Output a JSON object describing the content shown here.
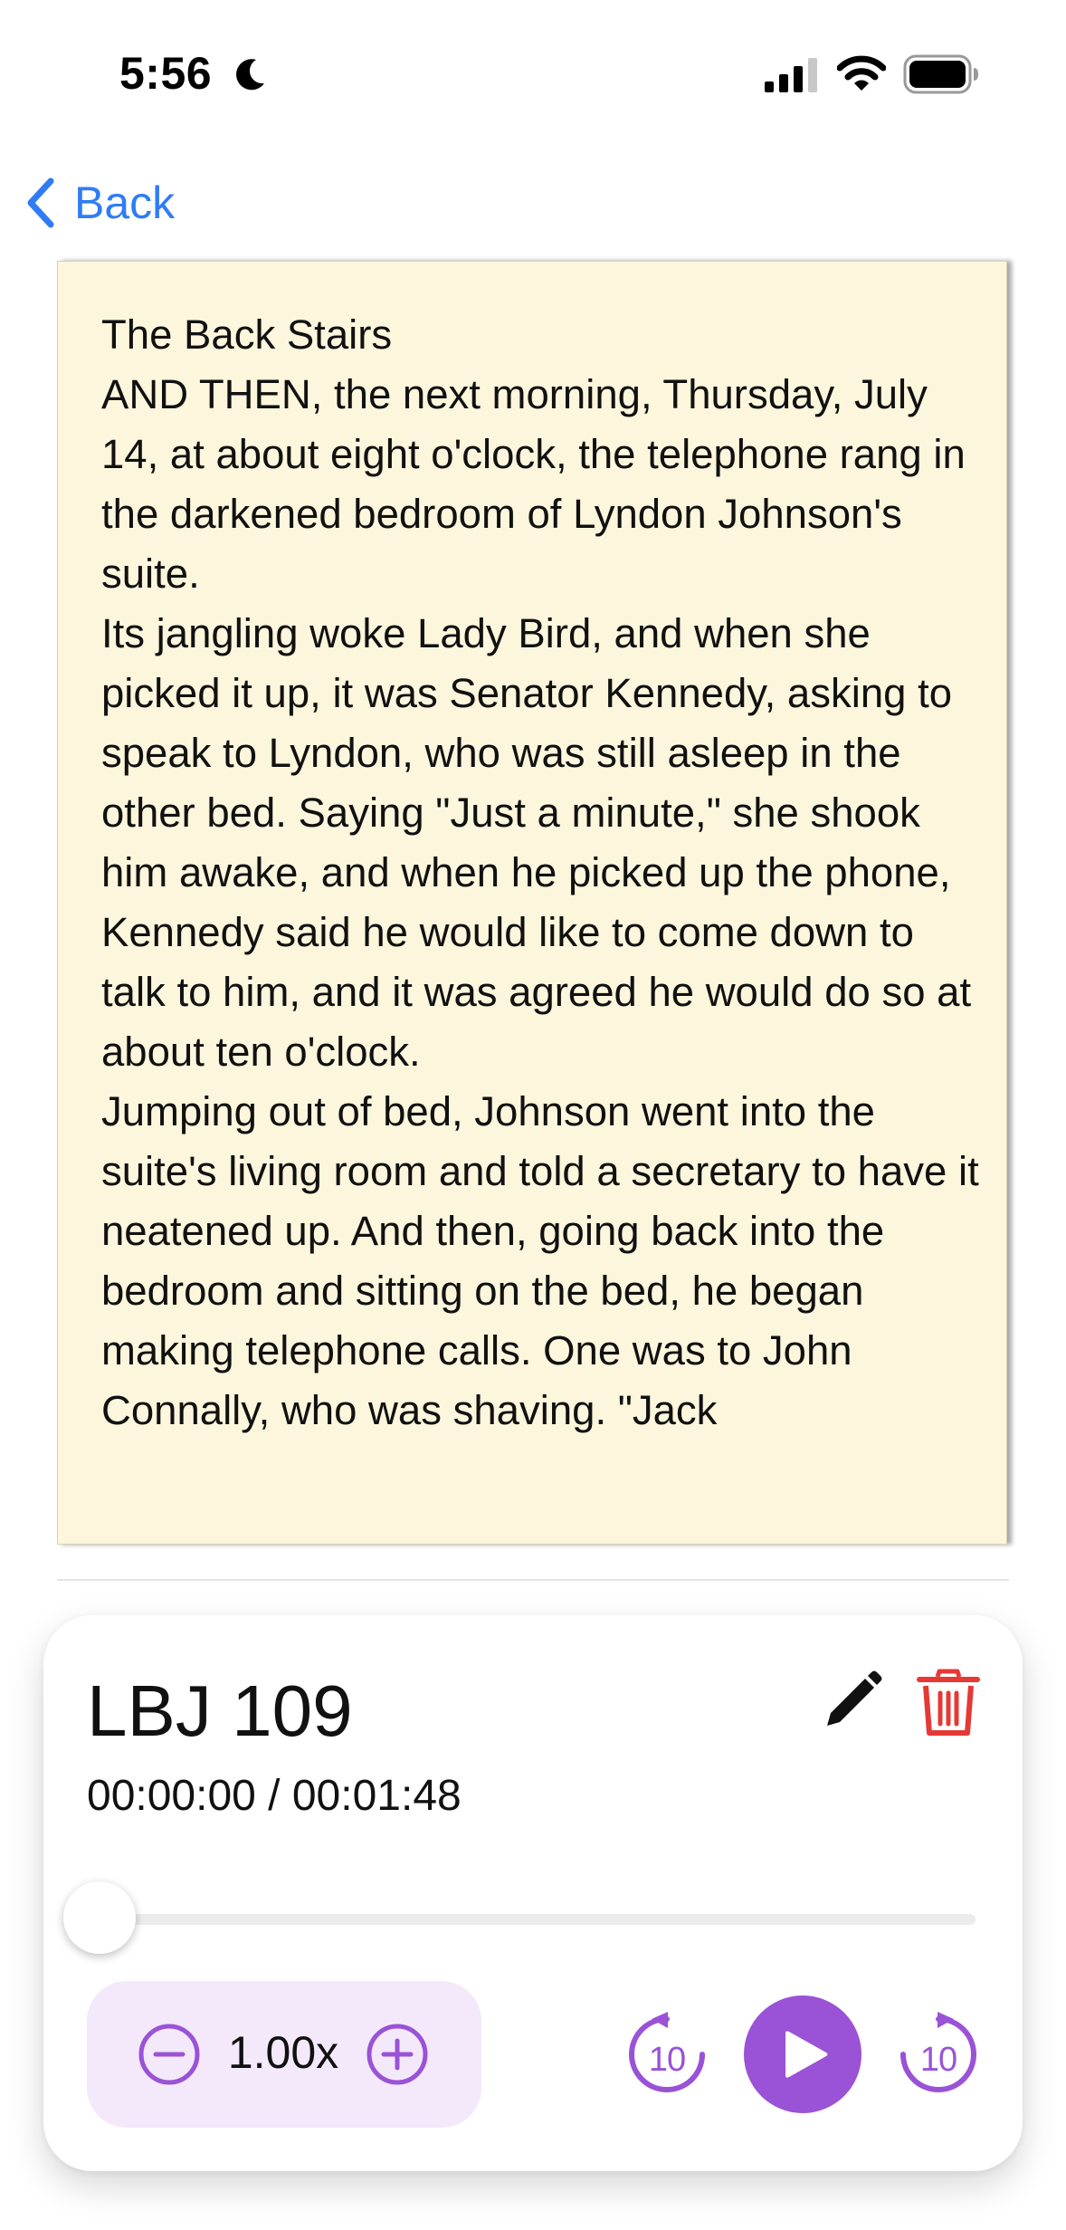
{
  "status_bar": {
    "time": "5:56",
    "icons": [
      "moon-icon",
      "cellular-signal-icon",
      "wifi-icon",
      "battery-icon"
    ]
  },
  "nav": {
    "back_label": "Back",
    "back_icon": "chevron-left-icon"
  },
  "transcript": {
    "paragraphs": [
      "The Back Stairs",
      "AND THEN, the next morning, Thursday, July 14, at about eight o'clock, the telephone rang in the darkened bedroom of Lyndon Johnson's suite.",
      "Its jangling woke Lady Bird, and when she picked it up, it was Senator Kennedy, asking to speak to Lyndon, who was still asleep in the other bed. Saying \"Just a minute,\" she shook him awake, and when he picked up the phone, Kennedy said he would like to come down to talk to him, and it was agreed he would do so at about ten o'clock.",
      "Jumping out of bed, Johnson went into the suite's living room and told a secretary to have it neatened up. And then, going back into the bedroom and sitting on the bed, he began making telephone calls. One was to John Connally, who was shaving. \"Jack"
    ]
  },
  "player": {
    "title": "LBJ 109",
    "current_time": "00:00:00",
    "separator": " / ",
    "duration": "00:01:48",
    "progress": 0,
    "speed": "1.00x",
    "skip_back_seconds": "10",
    "skip_forward_seconds": "10",
    "icons": {
      "edit": "pencil-icon",
      "delete": "trash-icon",
      "speed_down": "minus-circle-icon",
      "speed_up": "plus-circle-icon",
      "rewind": "rewind-10-icon",
      "play": "play-icon",
      "forward": "forward-10-icon"
    }
  },
  "colors": {
    "accent": "#9a52d6",
    "link": "#2f7cf6",
    "delete": "#e53935",
    "paper": "#fcf6dc",
    "speed_bg": "#f3e9fb"
  }
}
